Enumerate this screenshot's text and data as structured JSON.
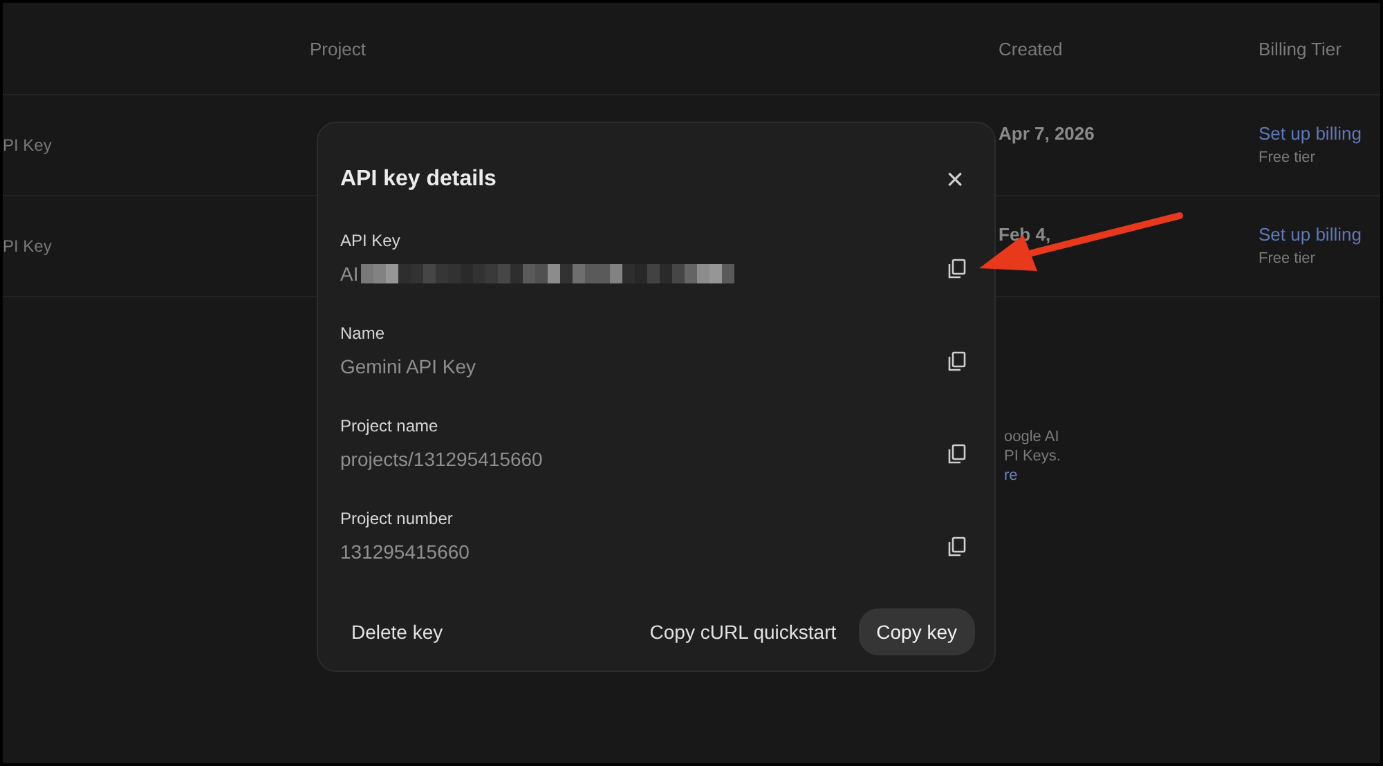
{
  "table": {
    "columns": [
      "Project",
      "Created",
      "Billing Tier"
    ],
    "rows": [
      {
        "name": "PI Key",
        "created": "Apr 7, 2026",
        "billing_link": "Set up billing",
        "tier": "Free tier"
      },
      {
        "name": "PI Key",
        "created": "Feb 4,",
        "billing_link": "Set up billing",
        "tier": "Free tier"
      }
    ]
  },
  "notice": {
    "lines": [
      "oogle AI",
      "PI Keys."
    ],
    "link": "re"
  },
  "dialog": {
    "title": "API key details",
    "close": "×",
    "fields": [
      {
        "label": "API Key",
        "value": "AI",
        "redacted": true
      },
      {
        "label": "Name",
        "value": "Gemini API Key",
        "redacted": false
      },
      {
        "label": "Project name",
        "value": "projects/131295415660",
        "redacted": false
      },
      {
        "label": "Project number",
        "value": "131295415660",
        "redacted": false
      }
    ],
    "buttons": [
      {
        "label": "Delete key",
        "kind": "text"
      },
      {
        "label": "Copy cURL quickstart",
        "kind": "text"
      },
      {
        "label": "Copy key",
        "kind": "filled"
      }
    ]
  },
  "annotation": {
    "kind": "arrow"
  }
}
